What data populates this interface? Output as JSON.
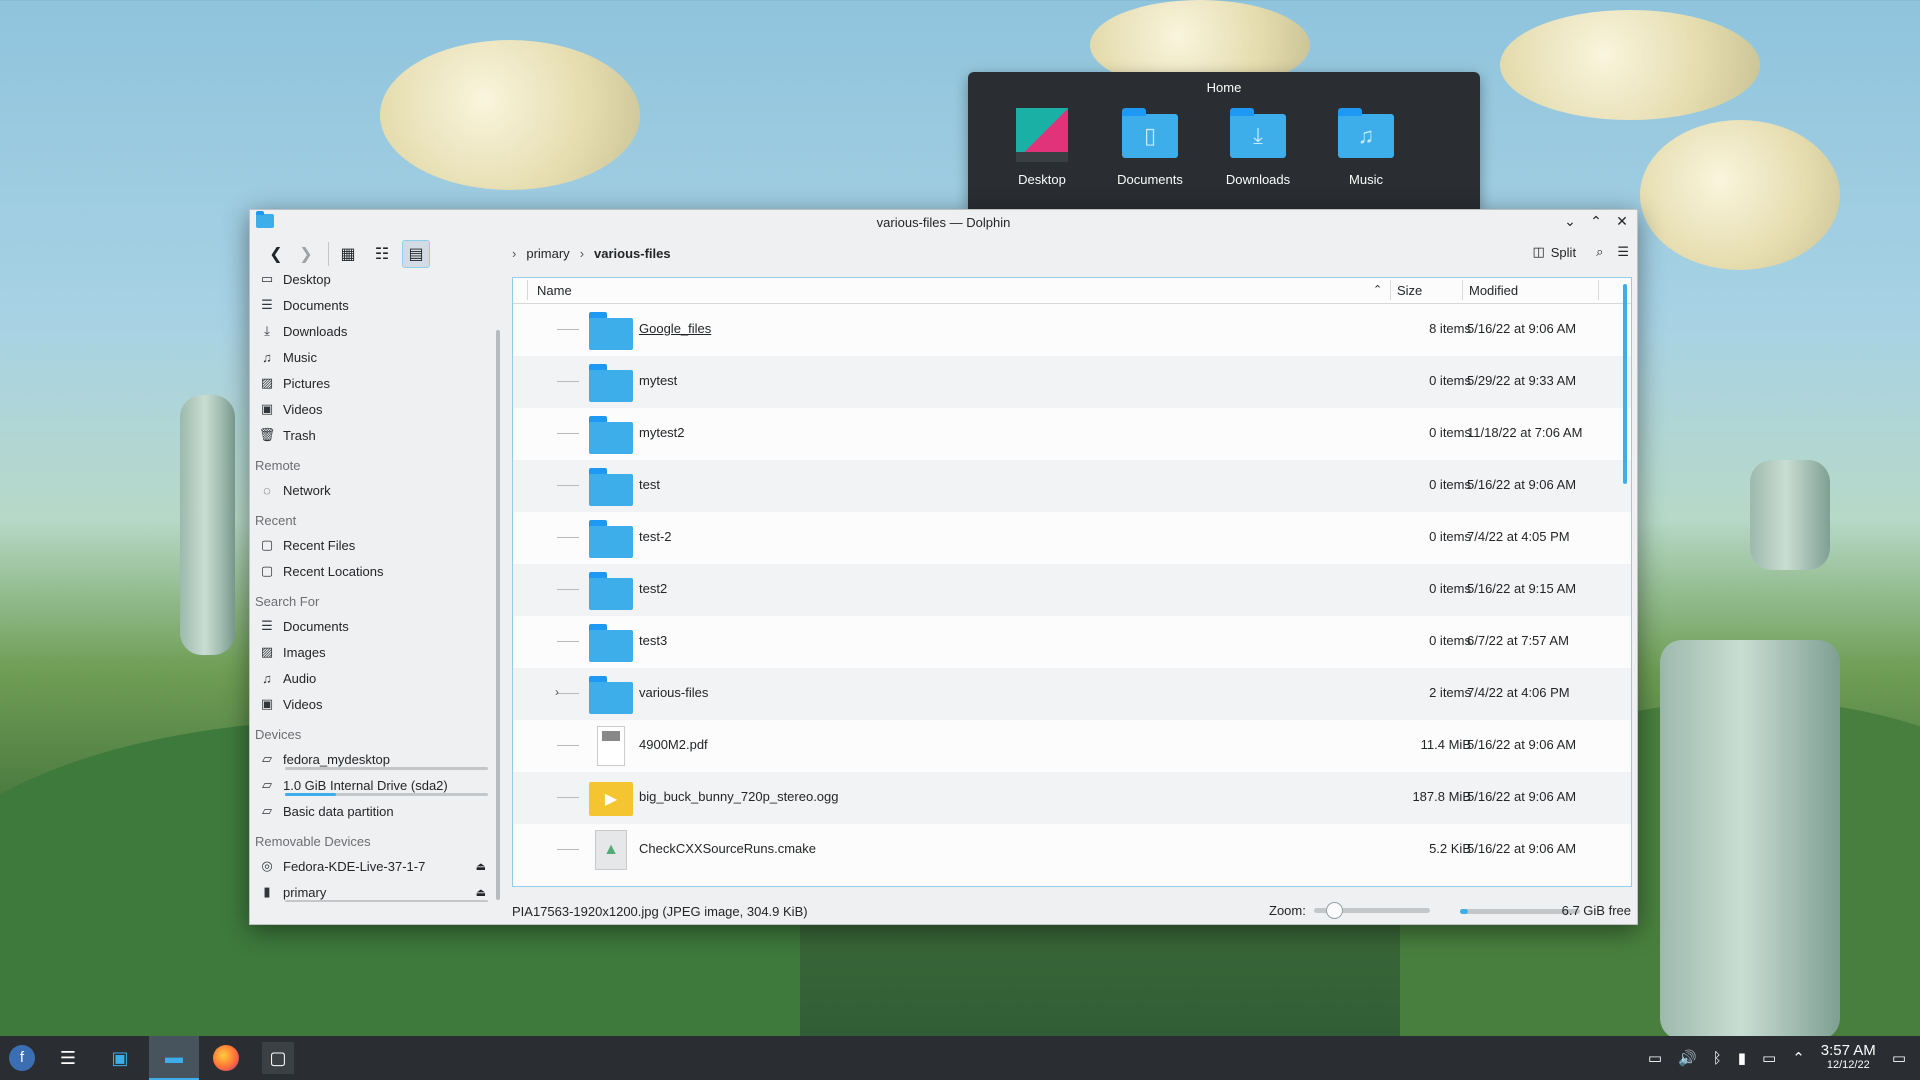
{
  "home_popup": {
    "title": "Home",
    "items": [
      {
        "label": "Desktop",
        "icon": "desktop-folder-icon"
      },
      {
        "label": "Documents",
        "icon": "documents-folder-icon"
      },
      {
        "label": "Downloads",
        "icon": "downloads-folder-icon"
      },
      {
        "label": "Music",
        "icon": "music-folder-icon"
      }
    ]
  },
  "window": {
    "title": "various-files — Dolphin",
    "controls": [
      "minimize",
      "maximize",
      "close"
    ]
  },
  "toolbar": {
    "breadcrumb": [
      "primary",
      "various-files"
    ],
    "split_label": "Split"
  },
  "sidebar": {
    "places": [
      {
        "label": "Desktop",
        "icon": "desktop-icon"
      },
      {
        "label": "Documents",
        "icon": "documents-icon"
      },
      {
        "label": "Downloads",
        "icon": "downloads-icon"
      },
      {
        "label": "Music",
        "icon": "music-icon"
      },
      {
        "label": "Pictures",
        "icon": "pictures-icon"
      },
      {
        "label": "Videos",
        "icon": "videos-icon"
      },
      {
        "label": "Trash",
        "icon": "trash-icon"
      }
    ],
    "remote_header": "Remote",
    "remote": [
      {
        "label": "Network",
        "icon": "network-icon"
      }
    ],
    "recent_header": "Recent",
    "recent": [
      {
        "label": "Recent Files",
        "icon": "recent-files-icon"
      },
      {
        "label": "Recent Locations",
        "icon": "recent-locations-icon"
      }
    ],
    "search_header": "Search For",
    "search": [
      {
        "label": "Documents",
        "icon": "documents-icon"
      },
      {
        "label": "Images",
        "icon": "images-icon"
      },
      {
        "label": "Audio",
        "icon": "audio-icon"
      },
      {
        "label": "Videos",
        "icon": "videos-icon"
      }
    ],
    "devices_header": "Devices",
    "devices": [
      {
        "label": "fedora_mydesktop",
        "icon": "drive-icon"
      },
      {
        "label": "1.0 GiB Internal Drive (sda2)",
        "icon": "drive-icon"
      },
      {
        "label": "Basic data partition",
        "icon": "drive-icon"
      }
    ],
    "removable_header": "Removable Devices",
    "removable": [
      {
        "label": "Fedora-KDE-Live-37-1-7",
        "icon": "optical-disc-icon"
      },
      {
        "label": "primary",
        "icon": "usb-drive-icon"
      }
    ]
  },
  "columns": {
    "name": "Name",
    "size": "Size",
    "modified": "Modified"
  },
  "files": [
    {
      "name": "Google_files",
      "size": "8 items",
      "modified": "5/16/22 at 9:06 AM",
      "kind": "folder"
    },
    {
      "name": "mytest",
      "size": "0 items",
      "modified": "5/29/22 at 9:33 AM",
      "kind": "folder"
    },
    {
      "name": "mytest2",
      "size": "0 items",
      "modified": "11/18/22 at 7:06 AM",
      "kind": "folder"
    },
    {
      "name": "test",
      "size": "0 items",
      "modified": "5/16/22 at 9:06 AM",
      "kind": "folder"
    },
    {
      "name": "test-2",
      "size": "0 items",
      "modified": "7/4/22 at 4:05 PM",
      "kind": "folder"
    },
    {
      "name": "test2",
      "size": "0 items",
      "modified": "5/16/22 at 9:15 AM",
      "kind": "folder"
    },
    {
      "name": "test3",
      "size": "0 items",
      "modified": "6/7/22 at 7:57 AM",
      "kind": "folder"
    },
    {
      "name": "various-files",
      "size": "2 items",
      "modified": "7/4/22 at 4:06 PM",
      "kind": "folder"
    },
    {
      "name": "4900M2.pdf",
      "size": "11.4 MiB",
      "modified": "5/16/22 at 9:06 AM",
      "kind": "pdf"
    },
    {
      "name": "big_buck_bunny_720p_stereo.ogg",
      "size": "187.8 MiB",
      "modified": "5/16/22 at 9:06 AM",
      "kind": "ogg"
    },
    {
      "name": "CheckCXXSourceRuns.cmake",
      "size": "5.2 KiB",
      "modified": "5/16/22 at 9:06 AM",
      "kind": "cmake"
    }
  ],
  "statusbar": {
    "info": "PIA17563-1920x1200.jpg (JPEG image, 304.9 KiB)",
    "zoom_label": "Zoom:",
    "free": "6.7 GiB free"
  },
  "taskbar": {
    "time": "3:57 AM",
    "date": "12/12/22"
  },
  "colors": {
    "accent": "#3daee9",
    "panel": "#2a2e32",
    "window_bg": "#eff0f1"
  }
}
